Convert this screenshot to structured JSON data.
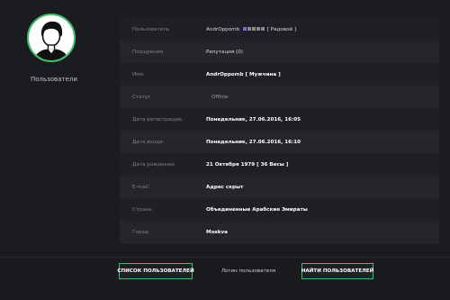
{
  "sidebar": {
    "title": "Пользователи"
  },
  "profile": {
    "rows": [
      {
        "label": "Пользователь",
        "value": "AndrOppomb",
        "suffix": "[ Рядовой ]"
      },
      {
        "label": "Поощрения",
        "value": "Репутация (0)"
      },
      {
        "label": "Имя:",
        "value": "AndrOppomb [ Мужчина ]"
      },
      {
        "label": "Статус",
        "value": "Offline"
      },
      {
        "label": "Дата регистрации:",
        "value": "Понедельник, 27.06.2016, 16:05"
      },
      {
        "label": "Дата входа:",
        "value": "Понедельник, 27.06.2016, 16:10"
      },
      {
        "label": "Дата рождения:",
        "value": "21 Октября 1979 [ 36 Весы ]"
      },
      {
        "label": "E-mail:",
        "value": "Адрес скрыт"
      },
      {
        "label": "Страна:",
        "value": "Объединенные Арабские Эмираты"
      },
      {
        "label": "Город:",
        "value": "Moskva"
      }
    ],
    "rank_colors": [
      "#7a6cc9",
      "#8a8a8a",
      "#8a8a8a",
      "#8a8a8a",
      "#8a8a8a"
    ]
  },
  "footer": {
    "list_button": "СПИСОК ПОЛЬЗОВАТЕЛЕЙ",
    "login_label": "Логин пользователя",
    "find_button": "НАЙТИ ПОЛЬЗОВАТЕЛЕЙ"
  },
  "colors": {
    "accent": "#3fbf6a",
    "background": "#1b1c20",
    "panel": "#1f2025"
  }
}
